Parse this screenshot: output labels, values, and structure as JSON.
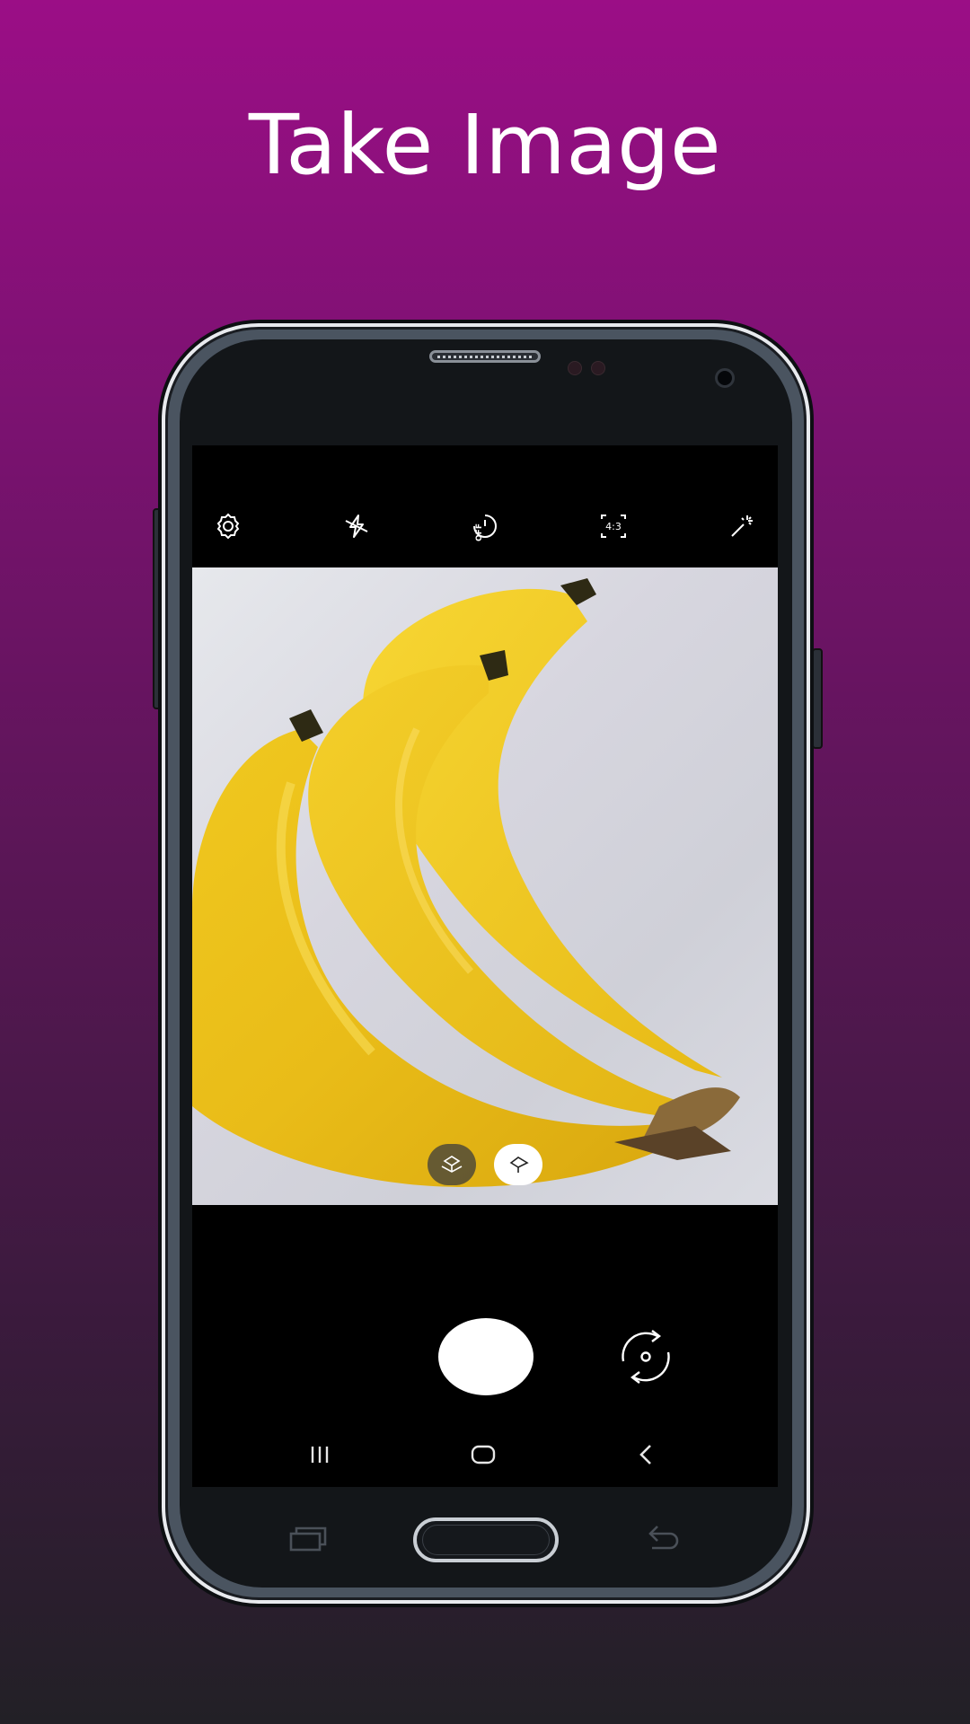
{
  "headline": "Take Image",
  "camera": {
    "top_icons": [
      "settings-icon",
      "flash-off-icon",
      "timer-off-icon",
      "aspect-ratio-icon",
      "effects-icon"
    ],
    "aspect_ratio_label": "4:3",
    "timer_label": "OFF",
    "lens_options": [
      "ultra-wide-lens-icon",
      "wide-lens-icon"
    ],
    "selected_lens": "wide-lens-icon"
  },
  "colors": {
    "background_top": "#9b0e86",
    "background_bottom": "#222026",
    "phone_body": "#131619",
    "screen": "#000000",
    "shutter": "#ffffff"
  },
  "navigation": {
    "software_keys": [
      "recent-apps-icon",
      "home-icon",
      "back-icon"
    ],
    "hardware_keys": [
      "hardware-recent-apps-icon",
      "home-key",
      "hardware-back-icon"
    ]
  }
}
